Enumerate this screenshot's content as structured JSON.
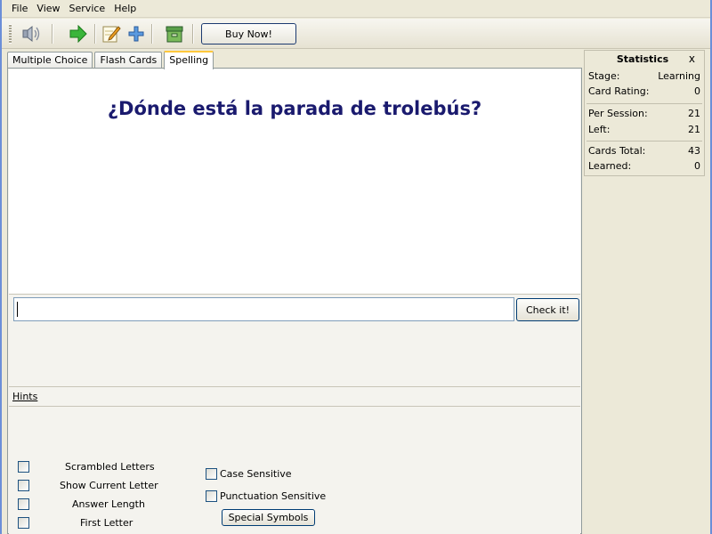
{
  "menu": [
    "File",
    "View",
    "Service",
    "Help"
  ],
  "toolbar": {
    "icons": [
      "speaker-icon",
      "arrow-right-icon",
      "edit-icon",
      "add-icon",
      "box-icon"
    ],
    "buy_label": "Buy Now!"
  },
  "tabs": [
    {
      "label": "Multiple Choice",
      "active": false
    },
    {
      "label": "Flash Cards",
      "active": false
    },
    {
      "label": "Spelling",
      "active": true
    }
  ],
  "question": "¿Dónde está la parada de trolebús?",
  "answer": {
    "value": "",
    "check_label": "Check it!"
  },
  "hints": {
    "title": "Hints",
    "options": [
      "Scrambled Letters",
      "Show Current Letter",
      "Answer Length",
      "First Letter"
    ],
    "options2": [
      "Case Sensitive",
      "Punctuation Sensitive"
    ],
    "special_label": "Special Symbols"
  },
  "stats": {
    "title": "Statistics",
    "close": "x",
    "rows": [
      {
        "label": "Stage:",
        "value": "Learning"
      },
      {
        "label": "Card Rating:",
        "value": "0"
      },
      {
        "label": "Per Session:",
        "value": "21"
      },
      {
        "label": "Left:",
        "value": "21"
      },
      {
        "label": "Cards Total:",
        "value": "43"
      },
      {
        "label": "Learned:",
        "value": "0"
      }
    ]
  }
}
